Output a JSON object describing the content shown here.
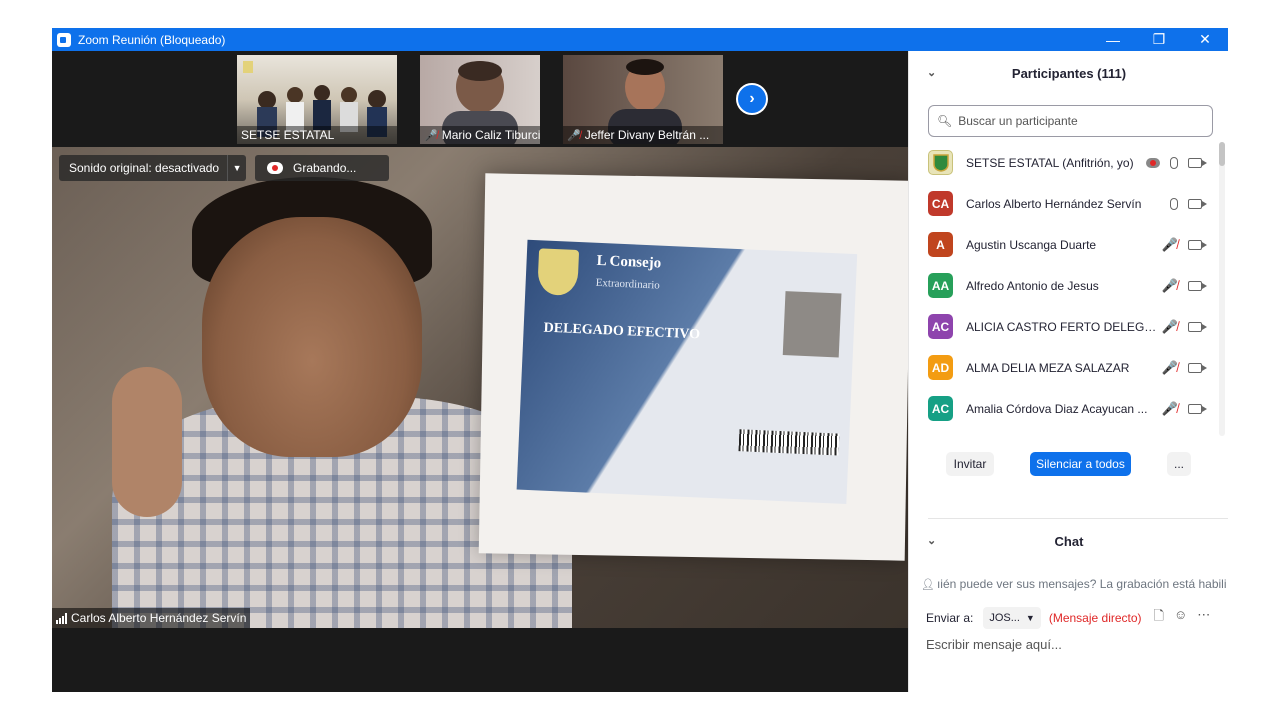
{
  "window": {
    "title": "Zoom Reunión (Bloqueado)",
    "minimize": "—",
    "restore": "❐",
    "close": "✕"
  },
  "thumbnails": [
    {
      "name": "SETSE ESTATAL",
      "muted": false
    },
    {
      "name": "Mario Caliz Tiburcio",
      "muted": true
    },
    {
      "name": "Jeffer Divany Beltrán ...",
      "muted": true
    }
  ],
  "next_button": "›",
  "audio": {
    "label": "Sonido original: desactivado",
    "caret": "▼"
  },
  "recording": {
    "label": "Grabando..."
  },
  "speaker": {
    "name": "Carlos Alberto Hernández Servín"
  },
  "credential": {
    "title": "L Consejo",
    "subtitle": "Extraordinario",
    "role": "DELEGADO EFECTIVO"
  },
  "participants": {
    "title": "Participantes (111)",
    "search_placeholder": "Buscar un participante",
    "list": [
      {
        "initials": "",
        "name": "SETSE ESTATAL (Anfitrión, yo)",
        "color": "#e8e4b8",
        "state": "host"
      },
      {
        "initials": "CA",
        "name": "Carlos Alberto Hernández Servín",
        "color": "#c0392b",
        "state": "mic"
      },
      {
        "initials": "A",
        "name": "Agustin Uscanga Duarte",
        "color": "#c0451e",
        "state": "muted"
      },
      {
        "initials": "AA",
        "name": "Alfredo Antonio de Jesus",
        "color": "#27a05a",
        "state": "muted"
      },
      {
        "initials": "AC",
        "name": "ALICIA CASTRO FERTO DELEGAC...",
        "color": "#8e44ad",
        "state": "muted"
      },
      {
        "initials": "AD",
        "name": "ALMA DELIA MEZA SALAZAR",
        "color": "#f39c12",
        "state": "muted"
      },
      {
        "initials": "AC",
        "name": "Amalia Córdova Diaz Acayucan ...",
        "color": "#16a085",
        "state": "muted"
      }
    ],
    "invite_label": "Invitar",
    "mute_all_label": "Silenciar a todos",
    "more_label": "..."
  },
  "chat": {
    "title": "Chat",
    "hint": "ıién puede ver sus mensajes? La grabación está habilit",
    "send_to_label": "Enviar a:",
    "recipient": "JOS...",
    "direct_label": "(Mensaje directo)",
    "input_placeholder": "Escribir mensaje aquí..."
  },
  "icons": {
    "chevron": "chevron-down-icon",
    "search": "search-icon",
    "file": "file-icon",
    "emoji": "emoji-icon",
    "more": "more-icon"
  }
}
